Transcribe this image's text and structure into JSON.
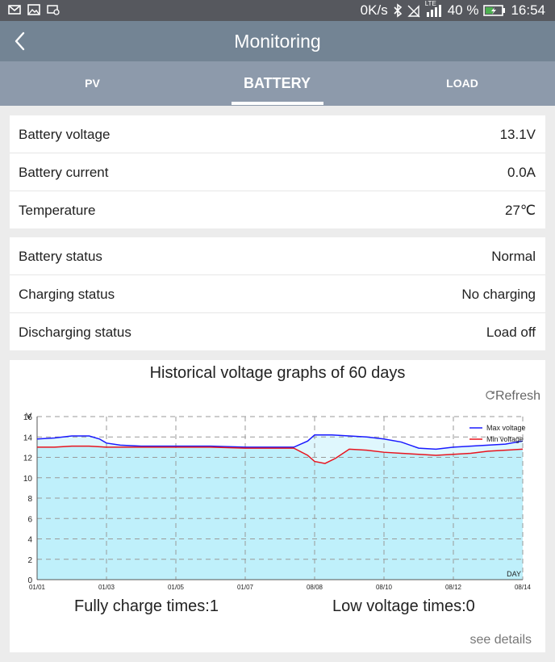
{
  "status_bar": {
    "speed": "0K/s",
    "network": "LTE",
    "battery_percent": "40 %",
    "time": "16:54",
    "icons": [
      "gmail-icon",
      "gallery-icon",
      "sync-icon",
      "bluetooth-icon",
      "no-signal-icon",
      "signal-icon",
      "battery-charging-icon"
    ]
  },
  "app_bar": {
    "title": "Monitoring"
  },
  "tabs": [
    {
      "label": "PV",
      "selected": false
    },
    {
      "label": "BATTERY",
      "selected": true
    },
    {
      "label": "LOAD",
      "selected": false
    }
  ],
  "battery_info": [
    {
      "label": "Battery voltage",
      "value": "13.1V"
    },
    {
      "label": "Battery current",
      "value": "0.0A"
    },
    {
      "label": "Temperature",
      "value": "27℃"
    }
  ],
  "status_info": [
    {
      "label": "Battery status",
      "value": "Normal"
    },
    {
      "label": "Charging status",
      "value": "No charging"
    },
    {
      "label": "Discharging status",
      "value": "Load off"
    }
  ],
  "history": {
    "title": "Historical voltage graphs of 60 days",
    "refresh_label": "Refresh",
    "fully_charge_label": "Fully charge times:1",
    "low_voltage_label": "Low voltage times:0",
    "see_details_label": "see details"
  },
  "chart_data": {
    "type": "line",
    "ylabel": "V",
    "xlabel": "DAY",
    "ylim": [
      0,
      16
    ],
    "yticks": [
      0,
      2,
      4,
      6,
      8,
      10,
      12,
      14,
      16
    ],
    "xlim": [
      0,
      14
    ],
    "xtick_labels": [
      "01/01",
      "01/03",
      "01/05",
      "01/07",
      "08/08",
      "08/10",
      "08/12",
      "08/14"
    ],
    "grid": true,
    "legend": "top-right",
    "colors": {
      "max": "#1a1aff",
      "min": "#e8141e",
      "fill": "#bff0fb"
    },
    "series": [
      {
        "name": "Max voltage",
        "x": [
          0,
          0.5,
          1,
          1.5,
          1.8,
          2,
          2.4,
          3,
          4,
          5,
          6,
          7,
          7.4,
          7.8,
          8,
          8.5,
          9,
          9.5,
          10,
          10.5,
          11,
          11.5,
          12,
          12.5,
          13,
          13.5,
          14
        ],
        "values": [
          13.8,
          13.9,
          14.1,
          14.1,
          13.8,
          13.4,
          13.2,
          13.1,
          13.1,
          13.1,
          13.0,
          13.0,
          13.0,
          13.6,
          14.2,
          14.2,
          14.1,
          14.0,
          13.8,
          13.5,
          12.9,
          12.8,
          13.0,
          13.1,
          13.2,
          13.3,
          13.6
        ]
      },
      {
        "name": "Min voltage",
        "x": [
          0,
          0.5,
          1,
          1.5,
          2,
          2.4,
          3,
          4,
          5,
          6,
          7,
          7.4,
          7.8,
          8,
          8.3,
          8.6,
          9,
          9.5,
          10,
          10.5,
          11,
          11.5,
          12,
          12.5,
          13,
          13.5,
          14
        ],
        "values": [
          13.0,
          13.0,
          13.1,
          13.1,
          13.0,
          13.0,
          13.0,
          13.0,
          13.0,
          12.9,
          12.9,
          12.9,
          12.2,
          11.6,
          11.4,
          11.9,
          12.8,
          12.7,
          12.5,
          12.4,
          12.3,
          12.2,
          12.3,
          12.4,
          12.6,
          12.7,
          12.8
        ]
      }
    ]
  }
}
